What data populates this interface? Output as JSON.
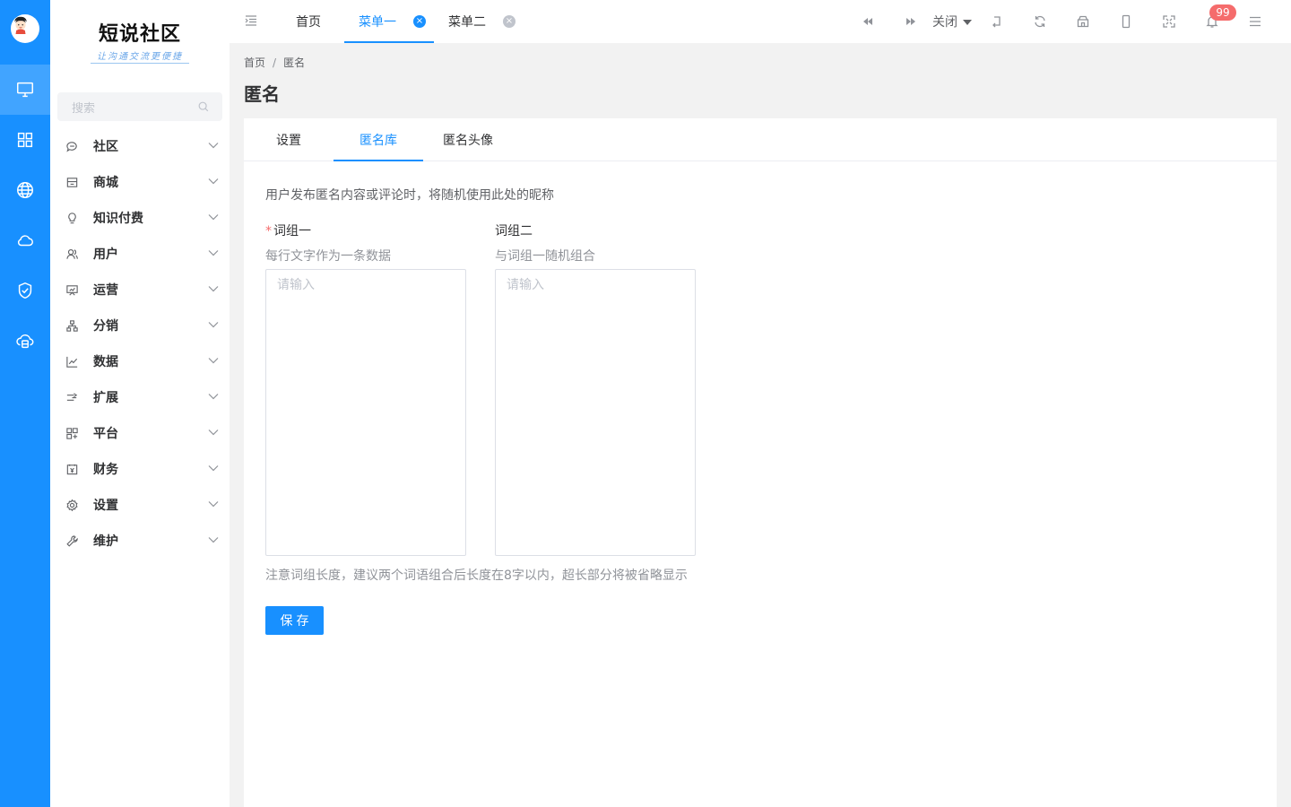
{
  "brand": {
    "title": "短说社区",
    "subtitle": "让沟通交流更便捷"
  },
  "colors": {
    "accent": "#1890ff",
    "rail_bg": "#1890ff",
    "danger": "#f56c6c"
  },
  "rail": {
    "items": [
      {
        "icon": "monitor-icon",
        "active": true
      },
      {
        "icon": "grid-icon"
      },
      {
        "icon": "globe-icon"
      },
      {
        "icon": "cloud-icon"
      },
      {
        "icon": "shield-check-icon"
      },
      {
        "icon": "cloud-server-icon"
      }
    ]
  },
  "sidebar": {
    "search_placeholder": "搜索",
    "items": [
      {
        "label": "社区",
        "icon": "chat-icon"
      },
      {
        "label": "商城",
        "icon": "store-icon"
      },
      {
        "label": "知识付费",
        "icon": "bulb-icon"
      },
      {
        "label": "用户",
        "icon": "users-icon"
      },
      {
        "label": "运营",
        "icon": "presentation-icon"
      },
      {
        "label": "分销",
        "icon": "hierarchy-icon"
      },
      {
        "label": "数据",
        "icon": "line-chart-icon"
      },
      {
        "label": "扩展",
        "icon": "extend-icon"
      },
      {
        "label": "平台",
        "icon": "apps-icon"
      },
      {
        "label": "财务",
        "icon": "finance-icon"
      },
      {
        "label": "设置",
        "icon": "gear-icon"
      },
      {
        "label": "维护",
        "icon": "wrench-icon"
      }
    ]
  },
  "topbar": {
    "tabs": [
      {
        "label": "首页",
        "closable": false,
        "active": false
      },
      {
        "label": "菜单一",
        "closable": true,
        "active": true
      },
      {
        "label": "菜单二",
        "closable": true,
        "active": false
      }
    ],
    "close_menu_label": "关闭",
    "notification_count": "99"
  },
  "breadcrumb": {
    "items": [
      "首页",
      "匿名"
    ],
    "separator": "/"
  },
  "page": {
    "title": "匿名",
    "tabs": [
      {
        "label": "设置",
        "active": false
      },
      {
        "label": "匿名库",
        "active": true
      },
      {
        "label": "匿名头像",
        "active": false
      }
    ],
    "description": "用户发布匿名内容或评论时，将随机使用此处的昵称",
    "group1": {
      "required_mark": "*",
      "label": "词组一",
      "help": "每行文字作为一条数据",
      "placeholder": "请输入",
      "value": ""
    },
    "group2": {
      "label": "词组二",
      "help": "与词组一随机组合",
      "placeholder": "请输入",
      "value": ""
    },
    "note": "注意词组长度，建议两个词语组合后长度在8字以内，超长部分将被省略显示",
    "save_label": "保存"
  }
}
